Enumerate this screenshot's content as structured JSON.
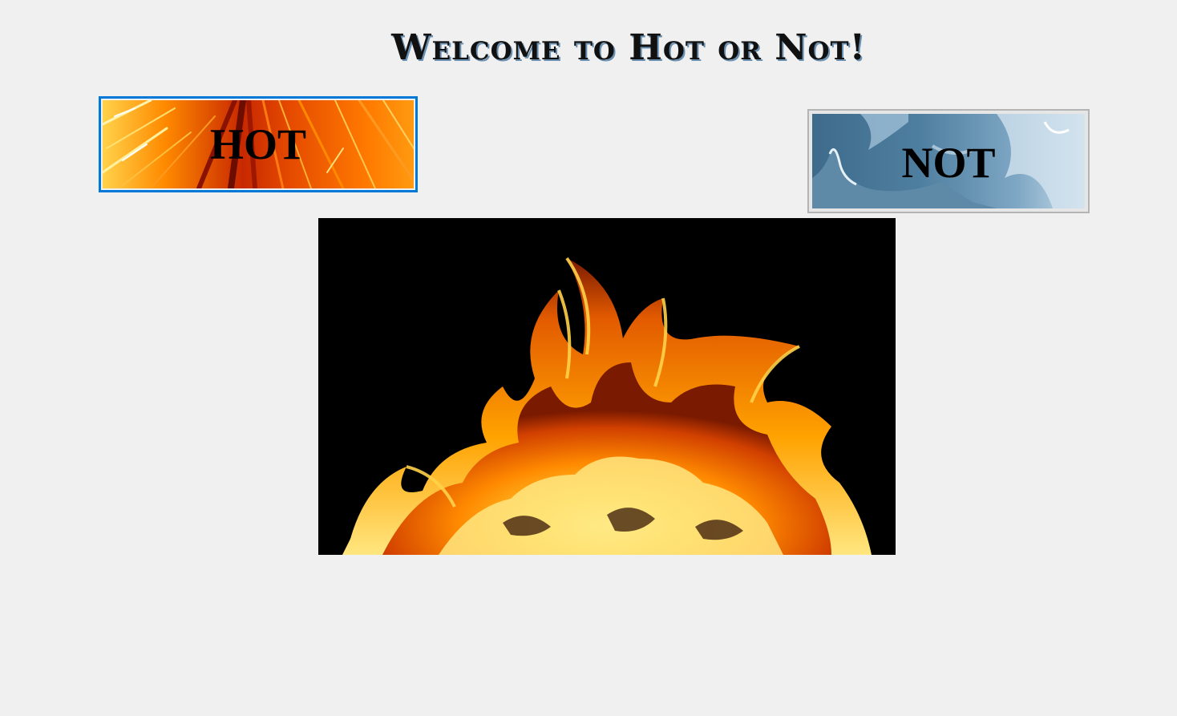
{
  "page": {
    "title": "Welcome to Hot or Not!"
  },
  "buttons": {
    "hot_label": "HOT",
    "not_label": "NOT"
  },
  "colors": {
    "background": "#f0f0f0",
    "hot_focus_border": "#0078d7",
    "not_border": "#b4b4b4"
  },
  "images": {
    "main": "fire-image",
    "hot_background": "lava-texture",
    "not_background": "sky-clouds"
  }
}
